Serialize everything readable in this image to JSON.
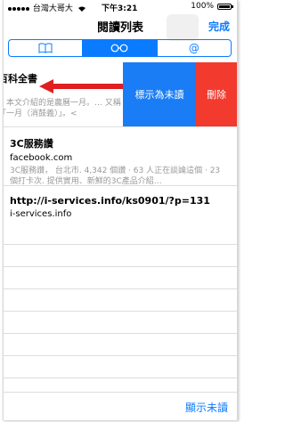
{
  "status": {
    "carrier": "台灣大哥大",
    "time": "下午3:21",
    "battery": "100%",
    "battery_level": 1.0
  },
  "nav": {
    "title": "閱讀列表",
    "done": "完成"
  },
  "tabs": [
    {
      "icon": "book-icon",
      "active": false
    },
    {
      "icon": "glasses-icon",
      "active": true
    },
    {
      "icon": "at-icon",
      "active": false
    }
  ],
  "items": [
    {
      "title": "百科全書",
      "description": "。本文介紹的是農曆一月。… 又稱「一月（消鼓義）」。<",
      "actions": {
        "mark_unread": "標示為未讀",
        "delete": "刪除"
      }
    },
    {
      "title": "3C服務讚",
      "domain": "facebook.com",
      "description": "3C服務讚， 台北市. 4,342 個讚 · 63 人正在談論這個 · 23 個打卡次. 提供實用、新鮮的3C產品介紹…"
    },
    {
      "title": "http://i-services.info/ks0901/?p=131",
      "domain": "i-services.info"
    }
  ],
  "footer": {
    "show_unread": "顯示未讀"
  },
  "colors": {
    "accent": "#0a7bff",
    "mark_unread_bg": "#1a7df5",
    "delete_bg": "#f23a2e",
    "arrow": "#e02020"
  }
}
